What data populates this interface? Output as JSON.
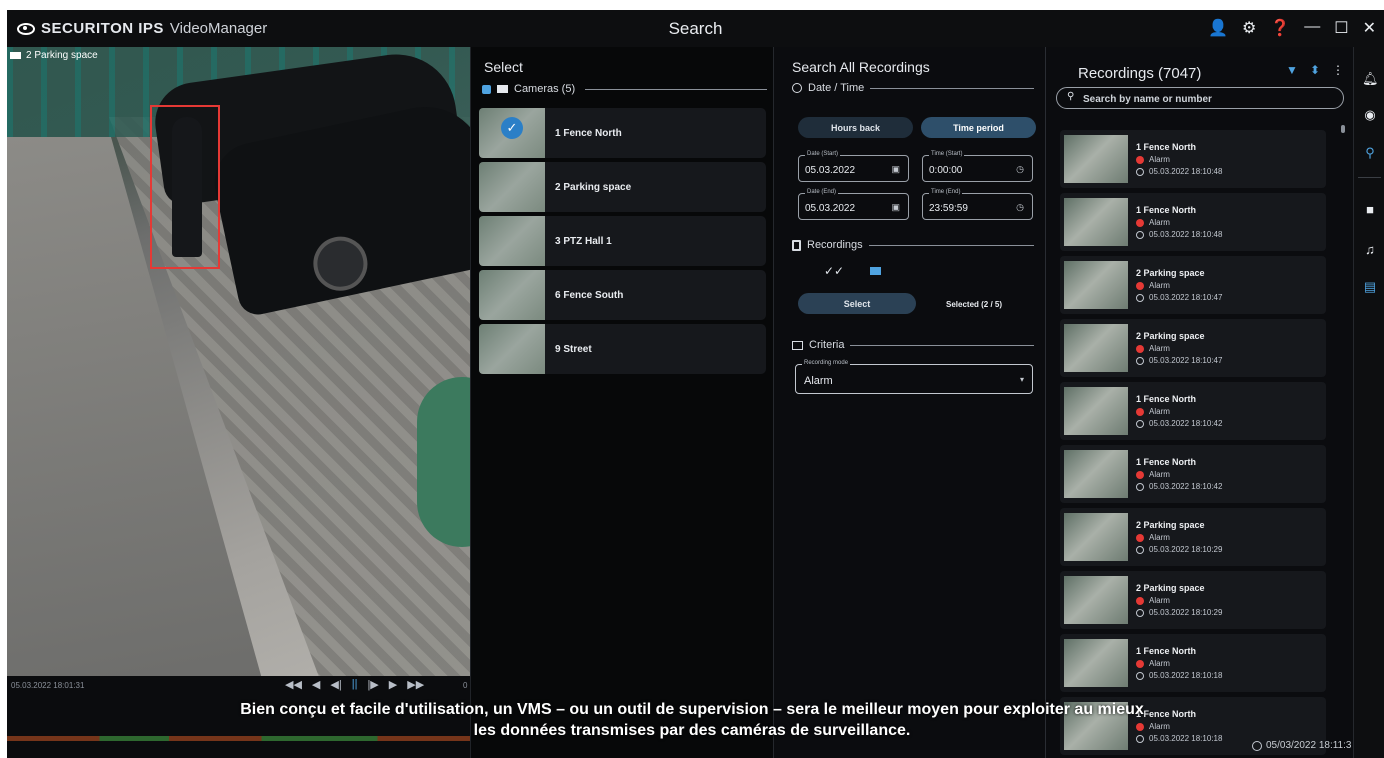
{
  "app": {
    "brand": "SECURITON IPS",
    "product": "VideoManager",
    "window_title": "Search",
    "controls": {
      "user": "👤",
      "settings": "⚙",
      "help": "❓",
      "minimize": "—",
      "maximize": "☐",
      "close": "✕"
    }
  },
  "video": {
    "camera_label": "2 Parking space",
    "timestamp": "05.03.2022 18:01:31",
    "controls": [
      "◀◀",
      "◀",
      "◀|",
      "||",
      "|▶",
      "▶",
      "▶▶"
    ],
    "zero": "0"
  },
  "select_panel": {
    "title": "Select",
    "cameras_label": "Cameras (5)",
    "cameras": [
      {
        "name": "1  Fence North"
      },
      {
        "name": "2  Parking space"
      },
      {
        "name": "3  PTZ Hall 1"
      },
      {
        "name": "6  Fence South"
      },
      {
        "name": "9  Street"
      }
    ]
  },
  "search_panel": {
    "title": "Search All Recordings",
    "date_time_label": "Date / Time",
    "hours_back": "Hours back",
    "time_period": "Time period",
    "date_start_label": "Date (Start)",
    "date_start": "05.03.2022",
    "time_start_label": "Time (Start)",
    "time_start": "0:00:00",
    "date_end_label": "Date (End)",
    "date_end": "05.03.2022",
    "time_end_label": "Time (End)",
    "time_end": "23:59:59",
    "recordings_label": "Recordings",
    "select_button": "Select",
    "selected_count": "Selected (2 / 5)",
    "criteria_label": "Criteria",
    "recording_mode_label": "Recording mode",
    "recording_mode": "Alarm"
  },
  "recordings": {
    "title": "Recordings (7047)",
    "search_placeholder": "Search by name or number",
    "items": [
      {
        "camera": "1  Fence North",
        "type": "Alarm",
        "time": "05.03.2022 18:10:48"
      },
      {
        "camera": "1  Fence North",
        "type": "Alarm",
        "time": "05.03.2022 18:10:48"
      },
      {
        "camera": "2  Parking space",
        "type": "Alarm",
        "time": "05.03.2022 18:10:47"
      },
      {
        "camera": "2  Parking space",
        "type": "Alarm",
        "time": "05.03.2022 18:10:47"
      },
      {
        "camera": "1  Fence North",
        "type": "Alarm",
        "time": "05.03.2022 18:10:42"
      },
      {
        "camera": "1  Fence North",
        "type": "Alarm",
        "time": "05.03.2022 18:10:42"
      },
      {
        "camera": "2  Parking space",
        "type": "Alarm",
        "time": "05.03.2022 18:10:29"
      },
      {
        "camera": "2  Parking space",
        "type": "Alarm",
        "time": "05.03.2022 18:10:29"
      },
      {
        "camera": "1  Fence North",
        "type": "Alarm",
        "time": "05.03.2022 18:10:18"
      },
      {
        "camera": "1  Fence North",
        "type": "Alarm",
        "time": "05.03.2022 18:10:18"
      }
    ]
  },
  "status": {
    "clock": "05/03/2022 18:11:3"
  },
  "caption": {
    "line1": "Bien conçu et facile d'utilisation, un VMS – ou un outil de supervision – sera le meilleur moyen pour exploiter au mieux",
    "line2": "les données transmises par des caméras de surveillance."
  },
  "colors": {
    "accent": "#4fa3e0",
    "alarm": "#e53935",
    "bbox": "#e53935"
  }
}
